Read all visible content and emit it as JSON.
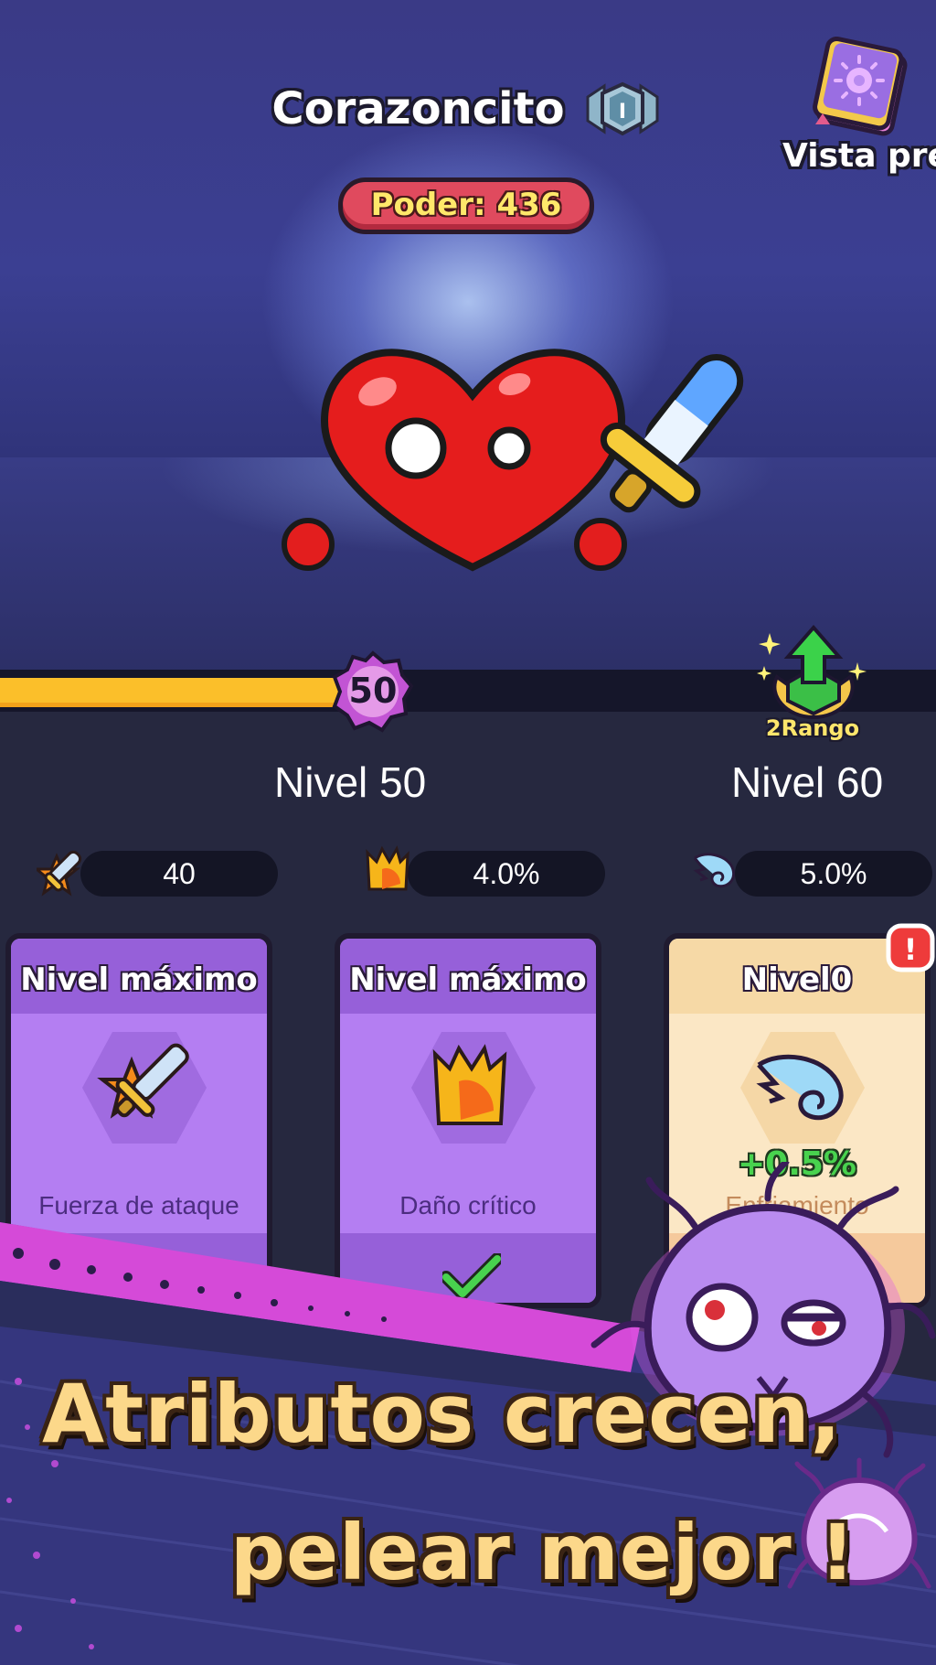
{
  "header": {
    "character_name": "Corazoncito",
    "rank_badge_numeral": "I",
    "power_label": "Poder: 436",
    "preview_button_label": "Vista previ"
  },
  "progress": {
    "current_level_badge": "50",
    "fill_fraction": 0.37,
    "rank_up_label": "2Rango",
    "current_level_label": "Nivel 50",
    "next_level_label": "Nivel 60"
  },
  "stats": [
    {
      "icon": "attack-icon",
      "value": "40"
    },
    {
      "icon": "crit-icon",
      "value": "4.0%"
    },
    {
      "icon": "wing-icon",
      "value": "5.0%"
    }
  ],
  "cards": [
    {
      "header": "Nivel máximo",
      "label": "Fuerza de ataque",
      "icon": "attack-icon",
      "completed": true
    },
    {
      "header": "Nivel máximo",
      "label": "Daño crítico",
      "icon": "crit-icon",
      "completed": true
    },
    {
      "header": "Nivel0",
      "label": "Enfriamiento",
      "bonus": "+0.5%",
      "icon": "wing-icon",
      "alert": "!"
    }
  ],
  "promo": {
    "line1": "Atributos crecen,",
    "line2": "pelear mejor !"
  },
  "colors": {
    "accent_yellow": "#fbbf2a",
    "power_pill": "#e04a5e",
    "card_purple": "#b47ef2",
    "card_cream": "#fbe7c5",
    "promo_text": "#fcd88a"
  }
}
